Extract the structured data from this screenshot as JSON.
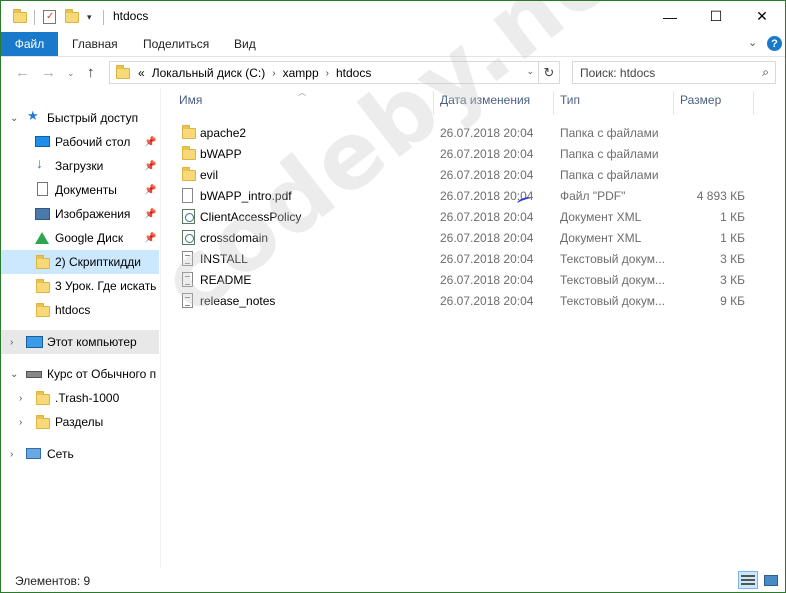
{
  "window": {
    "title": "htdocs"
  },
  "controls": {
    "minimize": "—",
    "maximize": "☐",
    "close": "✕"
  },
  "ribbon": {
    "file_tab": "Файл",
    "tabs": [
      "Главная",
      "Поделиться",
      "Вид"
    ],
    "help": "?"
  },
  "address": {
    "prefix": "«",
    "crumbs": [
      "Локальный диск (C:)",
      "xampp",
      "htdocs"
    ]
  },
  "search": {
    "placeholder": "Поиск: htdocs"
  },
  "nav": {
    "quick_access": "Быстрый доступ",
    "items": [
      {
        "label": "Рабочий стол",
        "icon": "desktop-icon",
        "pinned": true
      },
      {
        "label": "Загрузки",
        "icon": "downloads-icon",
        "pinned": true
      },
      {
        "label": "Документы",
        "icon": "documents-icon",
        "pinned": true
      },
      {
        "label": "Изображения",
        "icon": "pictures-icon",
        "pinned": true
      },
      {
        "label": "Google Диск",
        "icon": "google-drive-icon",
        "pinned": true
      },
      {
        "label": "2) Скрипткидди",
        "icon": "folder-icon",
        "pinned": false
      },
      {
        "label": "3 Урок. Где искать",
        "icon": "folder-icon",
        "pinned": false
      },
      {
        "label": "htdocs",
        "icon": "folder-icon",
        "pinned": false
      }
    ],
    "this_pc": "Этот компьютер",
    "drive": "Курс от Обычного п",
    "drive_children": [
      ".Trash-1000",
      "Разделы"
    ],
    "network": "Сеть"
  },
  "columns": {
    "name": "Имя",
    "date": "Дата изменения",
    "type": "Тип",
    "size": "Размер"
  },
  "files": [
    {
      "name": "apache2",
      "date": "26.07.2018 20:04",
      "type": "Папка с файлами",
      "size": "",
      "icon": "folder-icon"
    },
    {
      "name": "bWAPP",
      "date": "26.07.2018 20:04",
      "type": "Папка с файлами",
      "size": "",
      "icon": "folder-icon"
    },
    {
      "name": "evil",
      "date": "26.07.2018 20:04",
      "type": "Папка с файлами",
      "size": "",
      "icon": "folder-icon"
    },
    {
      "name": "bWAPP_intro.pdf",
      "date": "26.07.2018 20:04",
      "type": "Файл \"PDF\"",
      "size": "4 893 КБ",
      "icon": "pdf-file-icon"
    },
    {
      "name": "ClientAccessPolicy",
      "date": "26.07.2018 20:04",
      "type": "Документ XML",
      "size": "1 КБ",
      "icon": "xml-file-icon"
    },
    {
      "name": "crossdomain",
      "date": "26.07.2018 20:04",
      "type": "Документ XML",
      "size": "1 КБ",
      "icon": "xml-file-icon"
    },
    {
      "name": "INSTALL",
      "date": "26.07.2018 20:04",
      "type": "Текстовый докум...",
      "size": "3 КБ",
      "icon": "text-file-icon"
    },
    {
      "name": "README",
      "date": "26.07.2018 20:04",
      "type": "Текстовый докум...",
      "size": "3 КБ",
      "icon": "text-file-icon"
    },
    {
      "name": "release_notes",
      "date": "26.07.2018 20:04",
      "type": "Текстовый докум...",
      "size": "9 КБ",
      "icon": "text-file-icon"
    }
  ],
  "watermark": "codeby.net",
  "status": {
    "count": "Элементов: 9"
  }
}
